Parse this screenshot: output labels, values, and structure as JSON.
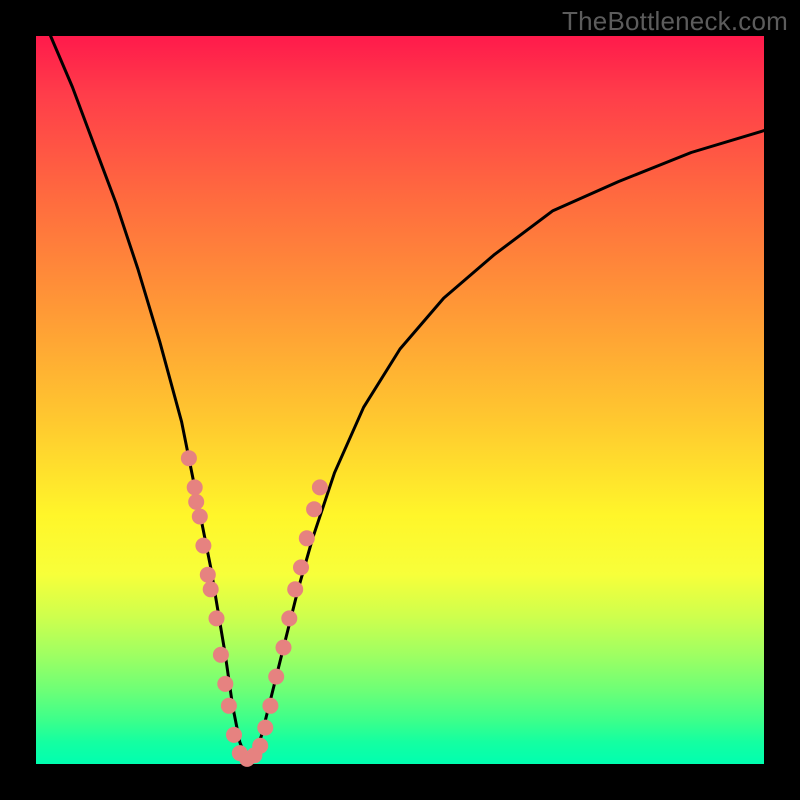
{
  "watermark": "TheBottleneck.com",
  "chart_data": {
    "type": "line",
    "title": "",
    "xlabel": "",
    "ylabel": "",
    "xlim": [
      0,
      100
    ],
    "ylim": [
      0,
      100
    ],
    "grid": false,
    "legend": false,
    "description": "V-shaped bottleneck curve over a red-to-green vertical gradient. Left branch descends steeply from top-left to a minimum near x≈29, right branch rises with decreasing slope toward the upper-right. Salmon scatter points cluster on both flanks of the valley in the lower third.",
    "series": [
      {
        "name": "bottleneck-curve",
        "x": [
          2,
          5,
          8,
          11,
          14,
          17,
          20,
          22,
          24,
          26,
          27,
          28,
          29,
          30,
          31,
          32,
          34,
          36,
          38,
          41,
          45,
          50,
          56,
          63,
          71,
          80,
          90,
          100
        ],
        "y": [
          100,
          93,
          85,
          77,
          68,
          58,
          47,
          37,
          27,
          15,
          8,
          3,
          0.5,
          1,
          4,
          8,
          16,
          24,
          31,
          40,
          49,
          57,
          64,
          70,
          76,
          80,
          84,
          87
        ]
      }
    ],
    "points": {
      "name": "sample-dots",
      "color": "#e68280",
      "xy": [
        [
          21.0,
          42
        ],
        [
          21.8,
          38
        ],
        [
          22.5,
          34
        ],
        [
          22.0,
          36
        ],
        [
          23.0,
          30
        ],
        [
          23.6,
          26
        ],
        [
          24.0,
          24
        ],
        [
          24.8,
          20
        ],
        [
          25.4,
          15
        ],
        [
          26.0,
          11
        ],
        [
          26.5,
          8
        ],
        [
          27.2,
          4
        ],
        [
          28.0,
          1.5
        ],
        [
          29.0,
          0.7
        ],
        [
          30.0,
          1.2
        ],
        [
          30.8,
          2.5
        ],
        [
          31.5,
          5
        ],
        [
          32.2,
          8
        ],
        [
          33.0,
          12
        ],
        [
          34.0,
          16
        ],
        [
          34.8,
          20
        ],
        [
          35.6,
          24
        ],
        [
          36.4,
          27
        ],
        [
          37.2,
          31
        ],
        [
          38.2,
          35
        ],
        [
          39.0,
          38
        ]
      ]
    }
  }
}
